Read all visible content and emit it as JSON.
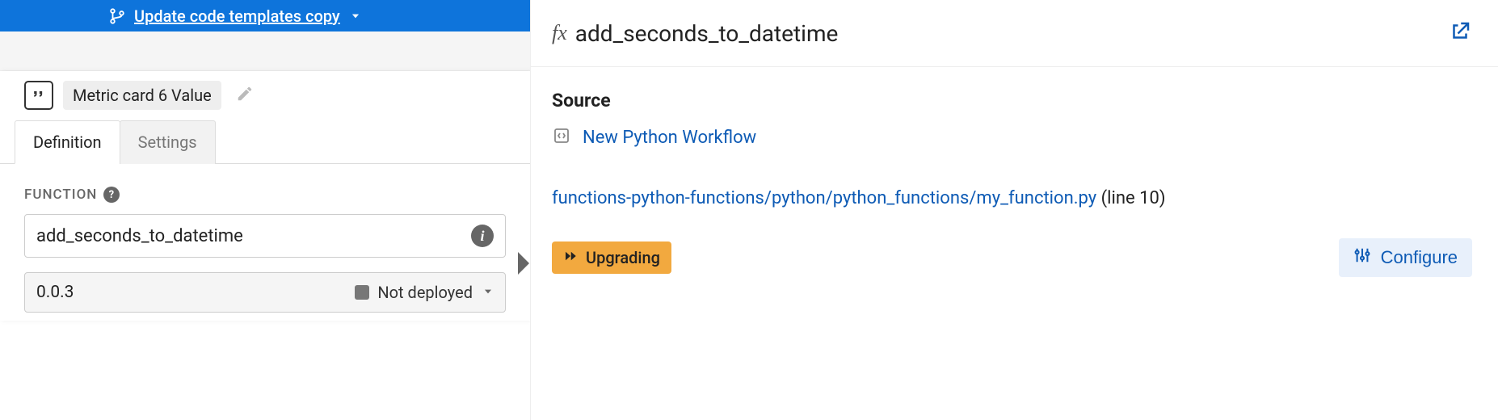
{
  "topbar": {
    "label": "Update code templates copy"
  },
  "left": {
    "title_chip": "Metric card 6 Value",
    "tabs": {
      "definition": "Definition",
      "settings": "Settings"
    },
    "function_label": "FUNCTION",
    "function_name": "add_seconds_to_datetime",
    "version": "0.0.3",
    "status": "Not deployed"
  },
  "right": {
    "fx": "fx",
    "title": "add_seconds_to_datetime",
    "source_heading": "Source",
    "workflow_link": "New Python Workflow",
    "path_link": "functions-python-functions/python/python_functions/my_function.py",
    "line_text": " (line 10)",
    "upgrading": "Upgrading",
    "configure": "Configure"
  }
}
